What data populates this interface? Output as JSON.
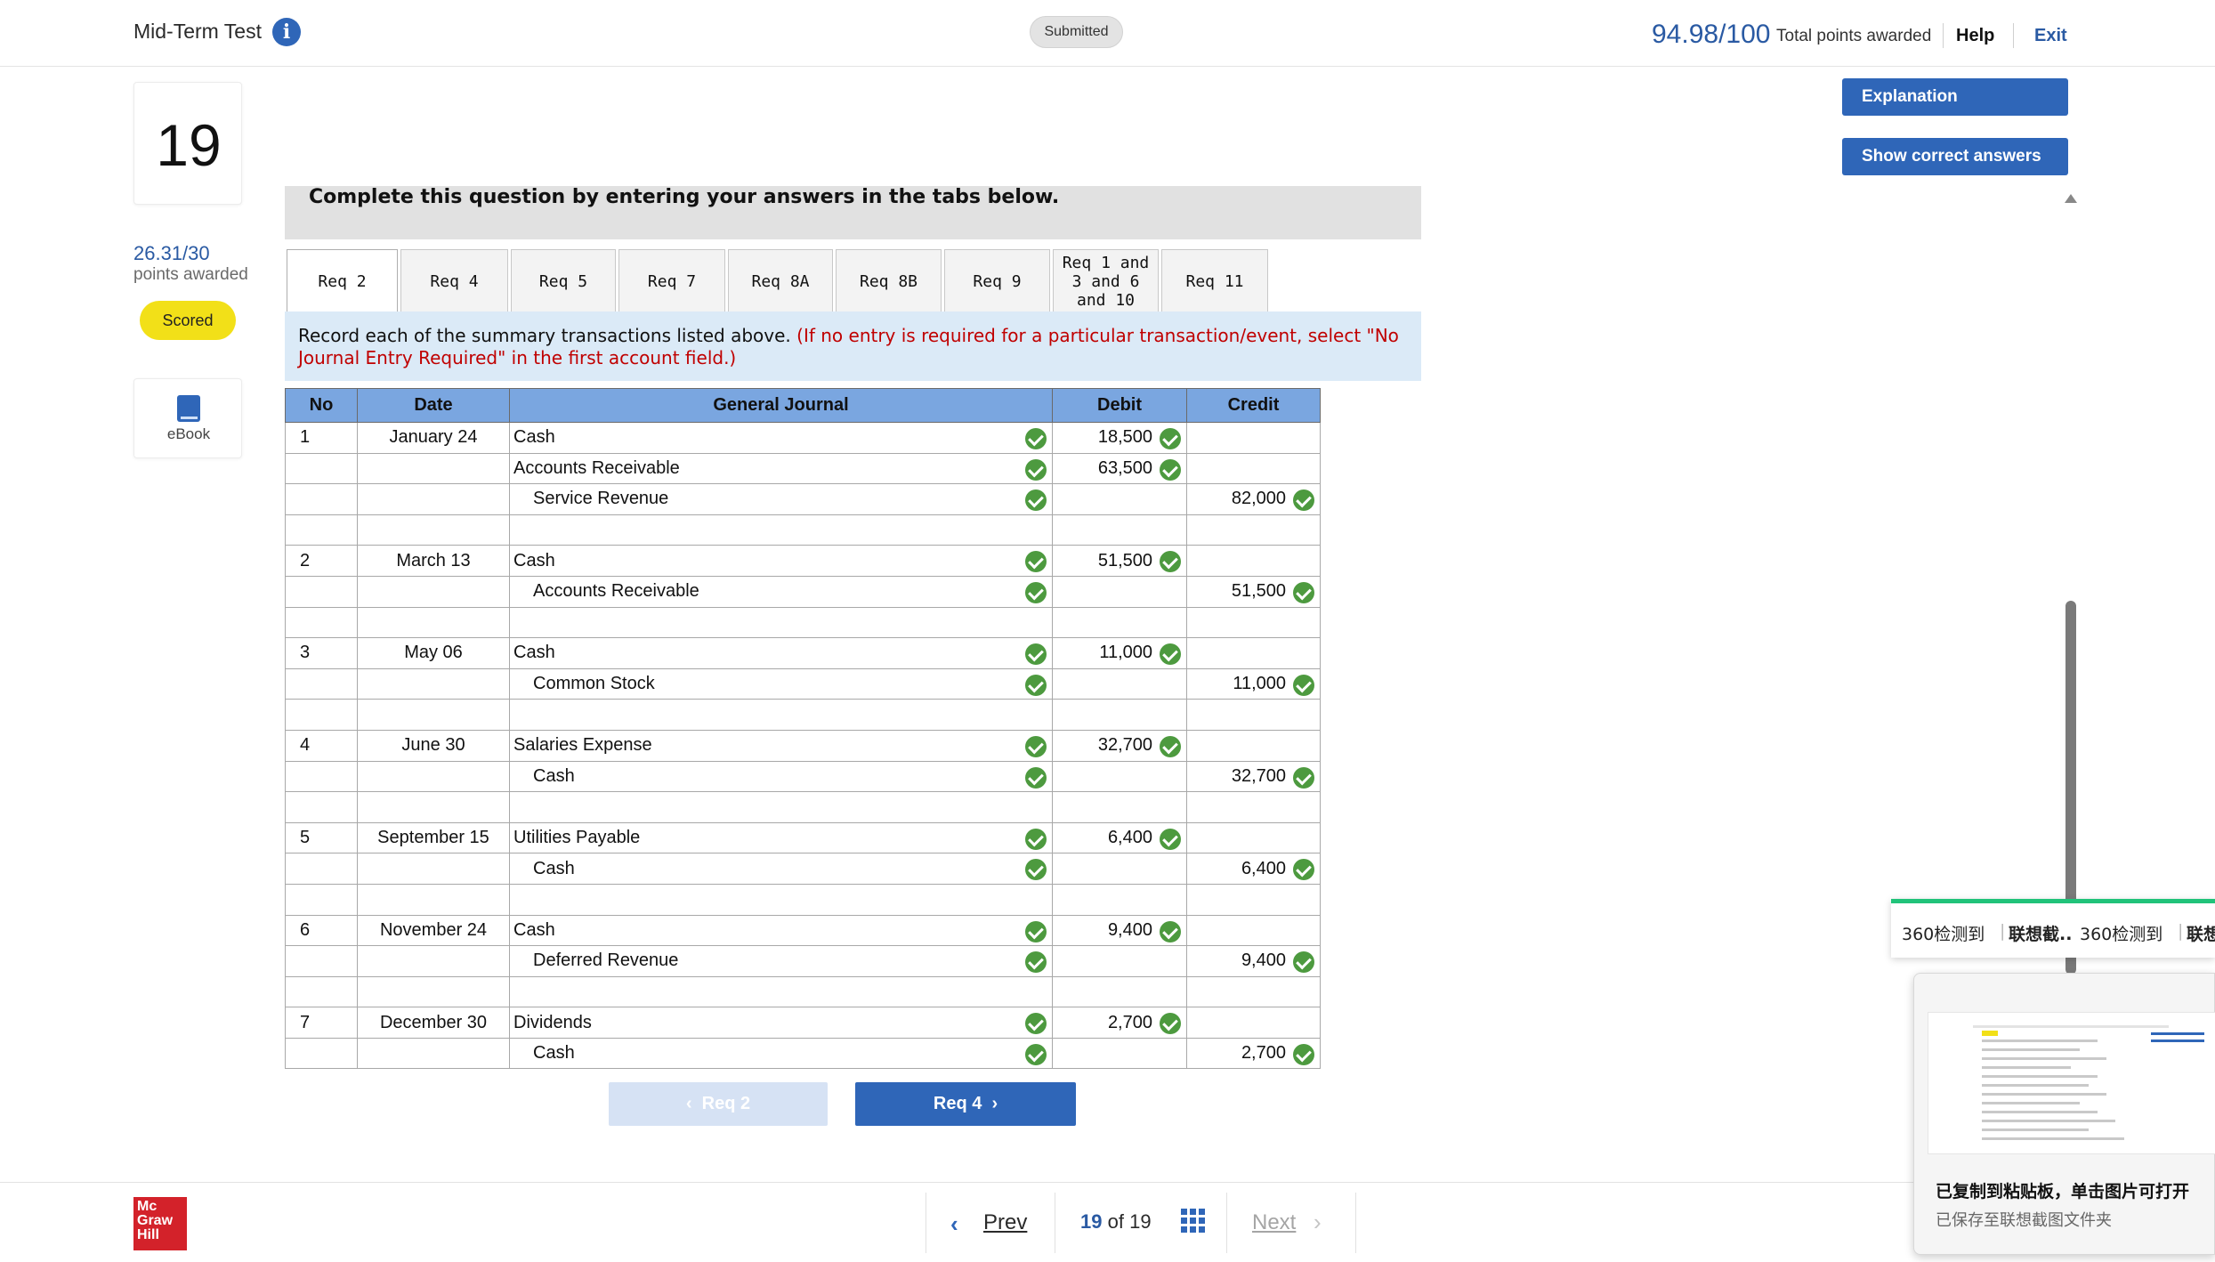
{
  "header": {
    "title": "Mid-Term Test",
    "status": "Submitted",
    "score": "94.98/100",
    "score_label": "Total points awarded",
    "help": "Help",
    "exit": "Exit"
  },
  "question": {
    "number": "19",
    "points": "26.31/30",
    "points_label": "points awarded",
    "badge": "Scored",
    "ebook": "eBook"
  },
  "actions": {
    "explanation": "Explanation",
    "show_answers": "Show correct answers"
  },
  "instructions": "Complete this question by entering your answers in the tabs below.",
  "tabs": [
    {
      "label": "Req 2",
      "active": true
    },
    {
      "label": "Req 4"
    },
    {
      "label": "Req 5"
    },
    {
      "label": "Req 7"
    },
    {
      "label": "Req 8A"
    },
    {
      "label": "Req 8B"
    },
    {
      "label": "Req 9"
    },
    {
      "label": "Req 1 and 3 and 6 and 10"
    },
    {
      "label": "Req 11"
    }
  ],
  "task": {
    "text": "Record each of the summary transactions listed above.",
    "note": "(If no entry is required for a particular transaction/event, select \"No Journal Entry Required\" in the first account field.)"
  },
  "journal": {
    "headers": [
      "No",
      "Date",
      "General Journal",
      "Debit",
      "Credit"
    ],
    "rows": [
      {
        "no": "1",
        "date": "January 24",
        "account": "Cash",
        "debit": "18,500",
        "credit": ""
      },
      {
        "no": "",
        "date": "",
        "account": "Accounts Receivable",
        "debit": "63,500",
        "credit": ""
      },
      {
        "no": "",
        "date": "",
        "account": "Service Revenue",
        "debit": "",
        "credit": "82,000",
        "indent": true
      },
      {
        "blank": true
      },
      {
        "no": "2",
        "date": "March 13",
        "account": "Cash",
        "debit": "51,500",
        "credit": ""
      },
      {
        "no": "",
        "date": "",
        "account": "Accounts Receivable",
        "debit": "",
        "credit": "51,500",
        "indent": true
      },
      {
        "blank": true
      },
      {
        "no": "3",
        "date": "May 06",
        "account": "Cash",
        "debit": "11,000",
        "credit": ""
      },
      {
        "no": "",
        "date": "",
        "account": "Common Stock",
        "debit": "",
        "credit": "11,000",
        "indent": true
      },
      {
        "blank": true
      },
      {
        "no": "4",
        "date": "June 30",
        "account": "Salaries Expense",
        "debit": "32,700",
        "credit": ""
      },
      {
        "no": "",
        "date": "",
        "account": "Cash",
        "debit": "",
        "credit": "32,700",
        "indent": true
      },
      {
        "blank": true
      },
      {
        "no": "5",
        "date": "September 15",
        "account": "Utilities Payable",
        "debit": "6,400",
        "credit": ""
      },
      {
        "no": "",
        "date": "",
        "account": "Cash",
        "debit": "",
        "credit": "6,400",
        "indent": true
      },
      {
        "blank": true
      },
      {
        "no": "6",
        "date": "November 24",
        "account": "Cash",
        "debit": "9,400",
        "credit": ""
      },
      {
        "no": "",
        "date": "",
        "account": "Deferred Revenue",
        "debit": "",
        "credit": "9,400",
        "indent": true
      },
      {
        "blank": true
      },
      {
        "no": "7",
        "date": "December 30",
        "account": "Dividends",
        "debit": "2,700",
        "credit": ""
      },
      {
        "no": "",
        "date": "",
        "account": "Cash",
        "debit": "",
        "credit": "2,700",
        "indent": true
      }
    ]
  },
  "req_nav": {
    "prev": "Req 2",
    "next": "Req 4"
  },
  "footer": {
    "logo": [
      "Mc",
      "Graw",
      "Hill"
    ],
    "prev": "Prev",
    "page_current": "19",
    "page_of": "of",
    "page_total": "19",
    "next": "Next"
  },
  "overlay": {
    "toast_a": "360检测到",
    "toast_b": "联想截..",
    "toast_c": "360检测到",
    "toast_d": "联想",
    "clip_title": "已复制到粘贴板，单击图片可打开",
    "clip_sub": "已保存至联想截图文件夹"
  },
  "colors": {
    "accent": "#2f66b8",
    "check": "#4d9a3f",
    "badge": "#f2e018",
    "note_red": "#c00000"
  }
}
